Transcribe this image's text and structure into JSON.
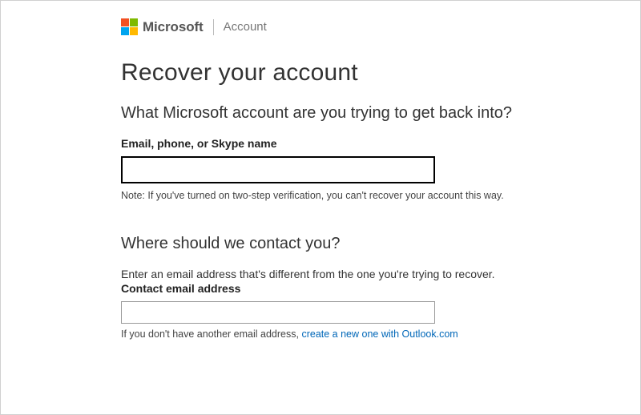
{
  "header": {
    "brand": "Microsoft",
    "section": "Account"
  },
  "main": {
    "title": "Recover your account",
    "subheading1": "What Microsoft account are you trying to get back into?",
    "field1_label": "Email, phone, or Skype name",
    "field1_value": "",
    "note1": "Note: If you've turned on two-step verification, you can't recover your account this way.",
    "subheading2": "Where should we contact you?",
    "helper2": "Enter an email address that's different from the one you're trying to recover.",
    "field2_label": "Contact email address",
    "field2_value": "",
    "footnote_prefix": "If you don't have another email address, ",
    "footnote_link": "create a new one with Outlook.com"
  }
}
